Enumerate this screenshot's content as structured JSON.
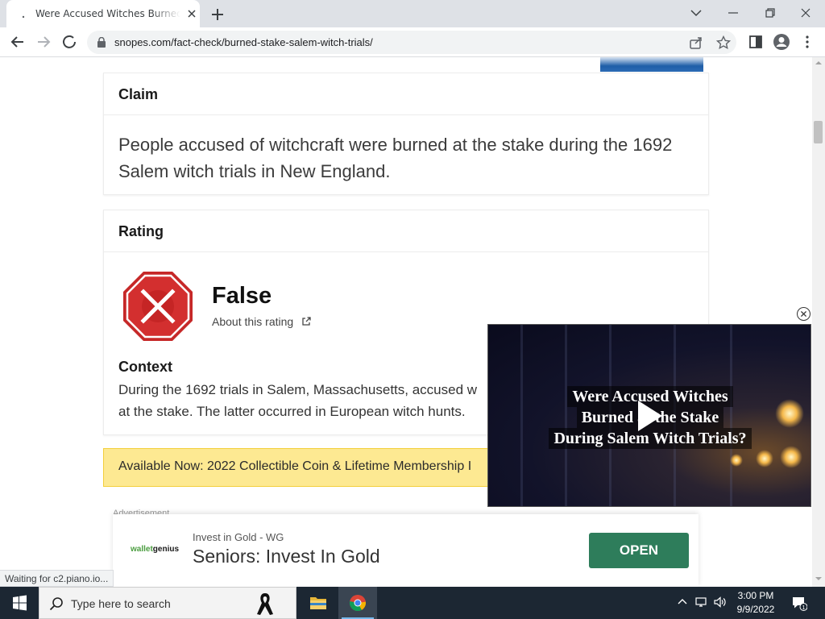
{
  "browser": {
    "tab_title": "Were Accused Witches Burned at the Stake",
    "url": "snopes.com/fact-check/burned-stake-salem-witch-trials/",
    "status_text": "Waiting for c2.piano.io..."
  },
  "claim": {
    "heading": "Claim",
    "text": "People accused of witchcraft were burned at the stake during the 1692 Salem witch trials in New England."
  },
  "rating": {
    "heading": "Rating",
    "value": "False",
    "about_link": "About this rating",
    "context_heading": "Context",
    "context_text": "During the 1692 trials in Salem, Massachusetts, accused w",
    "context_text_2": "at the stake. The latter occurred in European witch hunts."
  },
  "promo": {
    "text": "Available Now: 2022 Collectible Coin & Lifetime Membership I"
  },
  "advertisement_label": "Advertisement",
  "video": {
    "title_line1": "Were Accused Witches",
    "title_line2": "Burned at the Stake",
    "title_line3": "During Salem Witch Trials?"
  },
  "sticky_ad": {
    "logo_a": "wallet",
    "logo_b": "genius",
    "sponsor": "Invest in Gold - WG",
    "headline": "Seniors: Invest In Gold",
    "cta": "OPEN",
    "cta_color": "#2e7d5b"
  },
  "taskbar": {
    "search_placeholder": "Type here to search",
    "time": "3:00 PM",
    "date": "9/9/2022",
    "notification_count": "1"
  },
  "colors": {
    "rating_false": "#d32f2f",
    "promo_bg": "#fde992"
  }
}
